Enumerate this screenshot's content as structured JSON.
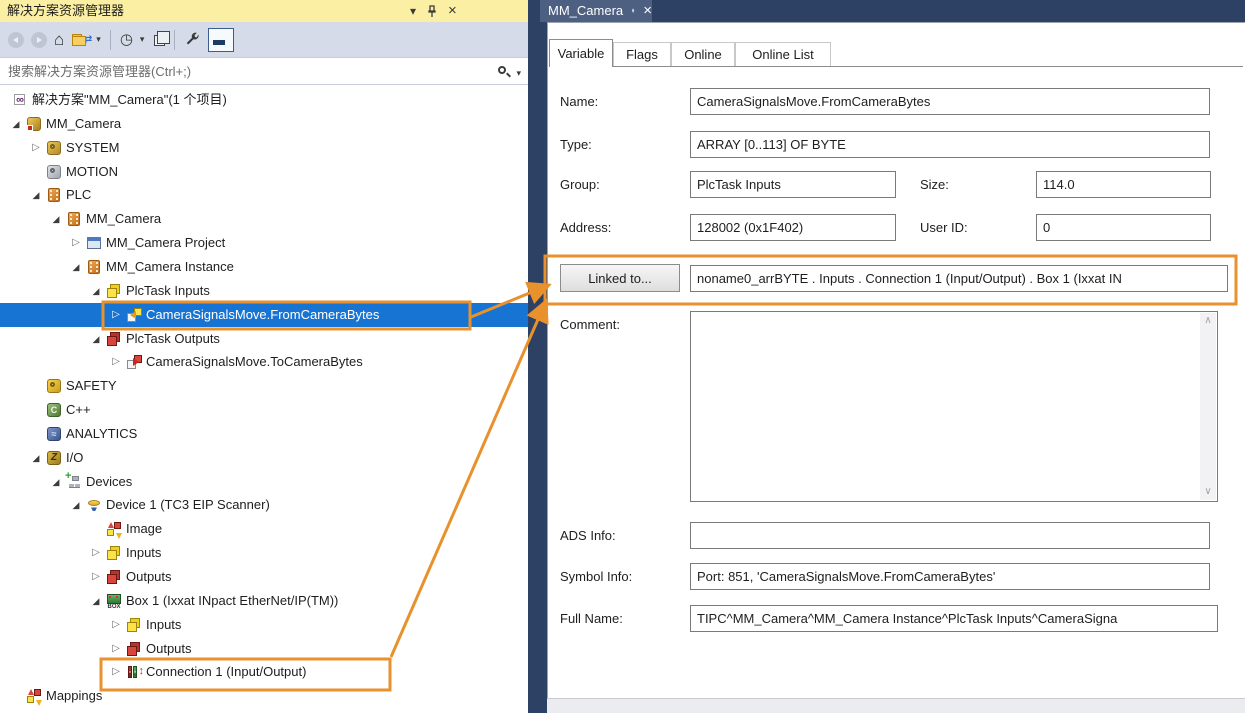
{
  "colors": {
    "annotation_orange": "#E8912D",
    "selection_blue": "#1874D2",
    "title_bar_yellow": "#FBEFA3",
    "tab_strip_navy": "#2C4164",
    "doc_tab_slate": "#4D6082"
  },
  "icon_glyphs": {
    "expander_expanded": "◢",
    "expander_collapsed": "▷",
    "close": "×",
    "caret_down": "▾",
    "home": "⌂",
    "clock": "◷",
    "sync_arrows": "⇄",
    "scroll_up": "∧",
    "scroll_down": "∨"
  },
  "solution_explorer": {
    "title": "解决方案资源管理器",
    "search": {
      "placeholder": "搜索解决方案资源管理器(Ctrl+;)"
    },
    "tree": [
      {
        "label": "解决方案\"MM_Camera\"(1 个项目)",
        "level": 0,
        "expander": "none",
        "icon": "vs-solution-icon"
      },
      {
        "label": "MM_Camera",
        "level": 1,
        "expander": "expanded",
        "icon": "twincat-project-icon"
      },
      {
        "label": "SYSTEM",
        "level": 2,
        "expander": "collapsed",
        "icon": "system-icon"
      },
      {
        "label": "MOTION",
        "level": 2,
        "expander": "none",
        "icon": "motion-icon"
      },
      {
        "label": "PLC",
        "level": 2,
        "expander": "expanded",
        "icon": "plc-icon"
      },
      {
        "label": "MM_Camera",
        "level": 3,
        "expander": "expanded",
        "icon": "plc-instance-icon"
      },
      {
        "label": "MM_Camera Project",
        "level": 4,
        "expander": "collapsed",
        "icon": "plc-project-icon"
      },
      {
        "label": "MM_Camera Instance",
        "level": 4,
        "expander": "expanded",
        "icon": "plc-instance-icon"
      },
      {
        "label": "PlcTask Inputs",
        "level": 5,
        "expander": "expanded",
        "icon": "task-inputs-icon"
      },
      {
        "label": "CameraSignalsMove.FromCameraBytes",
        "level": 6,
        "expander": "collapsed",
        "icon": "input-variable-icon",
        "selected": true,
        "highlight_boxed": true
      },
      {
        "label": "PlcTask Outputs",
        "level": 5,
        "expander": "expanded",
        "icon": "task-outputs-icon"
      },
      {
        "label": "CameraSignalsMove.ToCameraBytes",
        "level": 6,
        "expander": "collapsed",
        "icon": "output-variable-icon"
      },
      {
        "label": "SAFETY",
        "level": 2,
        "expander": "none",
        "icon": "safety-icon"
      },
      {
        "label": "C++",
        "level": 2,
        "expander": "none",
        "icon": "cpp-icon"
      },
      {
        "label": "ANALYTICS",
        "level": 2,
        "expander": "none",
        "icon": "analytics-icon"
      },
      {
        "label": "I/O",
        "level": 2,
        "expander": "expanded",
        "icon": "io-icon"
      },
      {
        "label": "Devices",
        "level": 3,
        "expander": "expanded",
        "icon": "devices-icon"
      },
      {
        "label": "Device 1 (TC3 EIP Scanner)",
        "level": 4,
        "expander": "expanded",
        "icon": "device-icon"
      },
      {
        "label": "Image",
        "level": 5,
        "expander": "none",
        "icon": "image-icon"
      },
      {
        "label": "Inputs",
        "level": 5,
        "expander": "collapsed",
        "icon": "task-inputs-icon"
      },
      {
        "label": "Outputs",
        "level": 5,
        "expander": "collapsed",
        "icon": "task-outputs-icon"
      },
      {
        "label": "Box 1 (Ixxat INpact EtherNet/IP(TM))",
        "level": 5,
        "expander": "expanded",
        "icon": "box-icon"
      },
      {
        "label": "Inputs",
        "level": 6,
        "expander": "collapsed",
        "icon": "task-inputs-icon"
      },
      {
        "label": "Outputs",
        "level": 6,
        "expander": "collapsed",
        "icon": "task-outputs-icon"
      },
      {
        "label": "Connection 1 (Input/Output)",
        "level": 6,
        "expander": "collapsed",
        "icon": "connection-icon",
        "highlight_boxed": true
      },
      {
        "label": "Mappings",
        "level": 1,
        "expander": "none",
        "icon": "mappings-icon"
      }
    ]
  },
  "document": {
    "tab_title": "MM_Camera",
    "tabs": [
      {
        "label": "Variable",
        "active": true
      },
      {
        "label": "Flags",
        "active": false
      },
      {
        "label": "Online",
        "active": false
      },
      {
        "label": "Online List",
        "active": false
      }
    ],
    "form": {
      "name": {
        "label": "Name:",
        "value": "CameraSignalsMove.FromCameraBytes"
      },
      "type": {
        "label": "Type:",
        "value": "ARRAY [0..113] OF BYTE"
      },
      "group": {
        "label": "Group:",
        "value": "PlcTask Inputs"
      },
      "size": {
        "label": "Size:",
        "value": "114.0"
      },
      "address": {
        "label": "Address:",
        "value": "128002 (0x1F402)"
      },
      "user_id": {
        "label": "User ID:",
        "value": "0"
      },
      "linked_to": {
        "button_label": "Linked to...",
        "value": "noname0_arrBYTE . Inputs . Connection 1 (Input/Output) . Box 1 (Ixxat IN"
      },
      "comment": {
        "label": "Comment:",
        "value": ""
      },
      "ads_info": {
        "label": "ADS Info:",
        "value": ""
      },
      "symbol_info": {
        "label": "Symbol Info:",
        "value": "Port: 851, 'CameraSignalsMove.FromCameraBytes'"
      },
      "full_name": {
        "label": "Full Name:",
        "value": "TIPC^MM_Camera^MM_Camera Instance^PlcTask Inputs^CameraSigna"
      }
    }
  }
}
